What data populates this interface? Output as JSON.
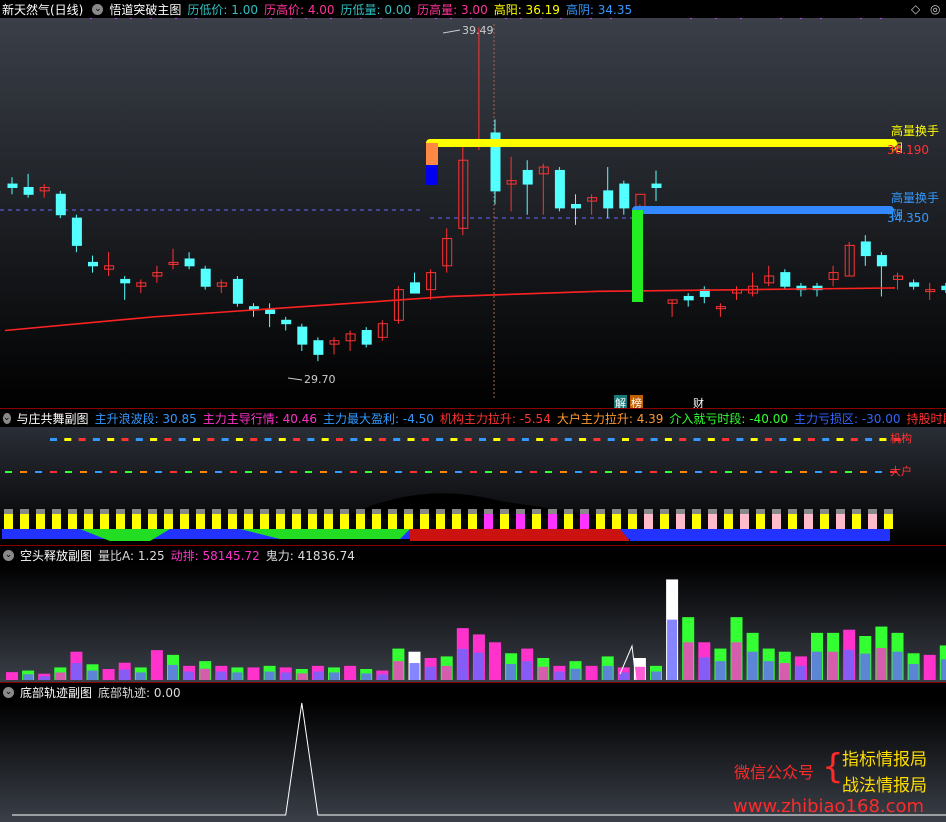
{
  "main": {
    "stock_name": "新天然气(日线)",
    "indicator_name": "悟道突破主图",
    "params": [
      {
        "label": "历低价:",
        "value": "1.00",
        "color": "#30c0c0"
      },
      {
        "label": "历高价:",
        "value": "4.00",
        "color": "#ff3399"
      },
      {
        "label": "历低量:",
        "value": "0.00",
        "color": "#30c0c0"
      },
      {
        "label": "历高量:",
        "value": "3.00",
        "color": "#ff3399"
      },
      {
        "label": "高阳:",
        "value": "36.19",
        "color": "#ffff00"
      },
      {
        "label": "高阴:",
        "value": "34.35",
        "color": "#3399ff"
      }
    ],
    "high_label": "39.49",
    "low_label": "29.70",
    "hline1": {
      "text": "高量换手阳",
      "value": "36.190"
    },
    "hline2": {
      "text": "高量换手阴",
      "value": "34.350"
    },
    "event_tags": [
      "解",
      "榜",
      "财"
    ]
  },
  "sub1": {
    "name": "与庄共舞副图",
    "params": [
      {
        "label": "主升浪波段:",
        "value": "30.85",
        "color": "#3399ff"
      },
      {
        "label": "主力主导行情:",
        "value": "40.46",
        "color": "#ff33cc"
      },
      {
        "label": "主力最大盈利:",
        "value": "-4.50",
        "color": "#3399ff"
      },
      {
        "label": "机构主力拉升:",
        "value": "-5.54",
        "color": "#ff3333"
      },
      {
        "label": "大户主力拉升:",
        "value": "4.39",
        "color": "#ff9933"
      },
      {
        "label": "介入就亏时段:",
        "value": "-40.00",
        "color": "#33ff33"
      },
      {
        "label": "主力亏损区:",
        "value": "-30.00",
        "color": "#3366ff"
      },
      {
        "label": "持股时段:",
        "value": "0.00",
        "color": "#ff3333"
      }
    ],
    "label_jigou": "机构",
    "label_dahu": "大户"
  },
  "sub2": {
    "name": "空头释放副图",
    "params": [
      {
        "label": "量比A:",
        "value": "1.25",
        "color": "#dddddd"
      },
      {
        "label": "动排:",
        "value": "58145.72",
        "color": "#ff33cc"
      },
      {
        "label": "鬼力:",
        "value": "41836.74",
        "color": "#dddddd"
      }
    ]
  },
  "sub3": {
    "name": "底部轨迹副图",
    "params": [
      {
        "label": "底部轨迹:",
        "value": "0.00",
        "color": "#dddddd"
      }
    ]
  },
  "watermark": {
    "line1": "微信公众号",
    "brand1": "指标情报局",
    "brand2": "战法情报局",
    "url": "www.zhibiao168.com"
  },
  "chart_data": {
    "type": "candlestick",
    "ylim": [
      29.0,
      39.6
    ],
    "candles": [
      {
        "o": 34.9,
        "h": 35.1,
        "l": 34.6,
        "c": 34.8
      },
      {
        "o": 34.8,
        "h": 35.2,
        "l": 34.5,
        "c": 34.6
      },
      {
        "o": 34.7,
        "h": 34.9,
        "l": 34.5,
        "c": 34.8
      },
      {
        "o": 34.6,
        "h": 34.7,
        "l": 33.9,
        "c": 34.0
      },
      {
        "o": 33.9,
        "h": 34.0,
        "l": 32.9,
        "c": 33.1
      },
      {
        "o": 32.6,
        "h": 32.8,
        "l": 32.3,
        "c": 32.5
      },
      {
        "o": 32.4,
        "h": 32.9,
        "l": 32.2,
        "c": 32.5
      },
      {
        "o": 32.1,
        "h": 32.2,
        "l": 31.5,
        "c": 32.0
      },
      {
        "o": 31.9,
        "h": 32.1,
        "l": 31.7,
        "c": 32.0
      },
      {
        "o": 32.2,
        "h": 32.5,
        "l": 32.0,
        "c": 32.3
      },
      {
        "o": 32.6,
        "h": 33.0,
        "l": 32.4,
        "c": 32.6
      },
      {
        "o": 32.7,
        "h": 32.9,
        "l": 32.4,
        "c": 32.5
      },
      {
        "o": 32.4,
        "h": 32.5,
        "l": 31.8,
        "c": 31.9
      },
      {
        "o": 31.9,
        "h": 32.1,
        "l": 31.7,
        "c": 32.0
      },
      {
        "o": 32.1,
        "h": 32.2,
        "l": 31.3,
        "c": 31.4
      },
      {
        "o": 31.3,
        "h": 31.4,
        "l": 31.0,
        "c": 31.2
      },
      {
        "o": 31.2,
        "h": 31.4,
        "l": 30.7,
        "c": 31.1
      },
      {
        "o": 30.9,
        "h": 31.0,
        "l": 30.6,
        "c": 30.8
      },
      {
        "o": 30.7,
        "h": 30.8,
        "l": 30.0,
        "c": 30.2
      },
      {
        "o": 30.3,
        "h": 30.4,
        "l": 29.7,
        "c": 29.9
      },
      {
        "o": 30.2,
        "h": 30.4,
        "l": 29.9,
        "c": 30.3
      },
      {
        "o": 30.3,
        "h": 30.6,
        "l": 30.0,
        "c": 30.5
      },
      {
        "o": 30.6,
        "h": 30.7,
        "l": 30.1,
        "c": 30.2
      },
      {
        "o": 30.4,
        "h": 30.9,
        "l": 30.3,
        "c": 30.8
      },
      {
        "o": 30.9,
        "h": 31.9,
        "l": 30.8,
        "c": 31.8
      },
      {
        "o": 32.0,
        "h": 32.3,
        "l": 31.7,
        "c": 31.7
      },
      {
        "o": 31.8,
        "h": 32.4,
        "l": 31.5,
        "c": 32.3
      },
      {
        "o": 32.5,
        "h": 33.6,
        "l": 32.3,
        "c": 33.3
      },
      {
        "o": 33.6,
        "h": 36.0,
        "l": 33.4,
        "c": 35.6
      },
      {
        "o": 36.2,
        "h": 39.5,
        "l": 35.9,
        "c": 36.2
      },
      {
        "o": 36.4,
        "h": 36.8,
        "l": 34.3,
        "c": 34.7
      },
      {
        "o": 34.9,
        "h": 35.7,
        "l": 34.1,
        "c": 35.0
      },
      {
        "o": 35.3,
        "h": 35.6,
        "l": 34.0,
        "c": 34.9
      },
      {
        "o": 35.2,
        "h": 35.5,
        "l": 34.0,
        "c": 35.4
      },
      {
        "o": 35.3,
        "h": 35.4,
        "l": 34.1,
        "c": 34.2
      },
      {
        "o": 34.3,
        "h": 34.6,
        "l": 33.7,
        "c": 34.2
      },
      {
        "o": 34.4,
        "h": 34.6,
        "l": 34.0,
        "c": 34.5
      },
      {
        "o": 34.7,
        "h": 35.4,
        "l": 33.9,
        "c": 34.2
      },
      {
        "o": 34.9,
        "h": 35.0,
        "l": 34.0,
        "c": 34.2
      },
      {
        "o": 34.1,
        "h": 34.3,
        "l": 33.8,
        "c": 34.6
      },
      {
        "o": 34.9,
        "h": 35.3,
        "l": 34.4,
        "c": 34.8
      },
      {
        "o": 31.4,
        "h": 31.5,
        "l": 31.0,
        "c": 31.5
      },
      {
        "o": 31.6,
        "h": 31.7,
        "l": 31.3,
        "c": 31.5
      },
      {
        "o": 31.8,
        "h": 31.9,
        "l": 31.4,
        "c": 31.6
      },
      {
        "o": 31.3,
        "h": 31.4,
        "l": 31.0,
        "c": 31.3
      },
      {
        "o": 31.7,
        "h": 31.9,
        "l": 31.5,
        "c": 31.8
      },
      {
        "o": 31.7,
        "h": 32.3,
        "l": 31.6,
        "c": 31.9
      },
      {
        "o": 32.0,
        "h": 32.5,
        "l": 31.9,
        "c": 32.2
      },
      {
        "o": 32.3,
        "h": 32.4,
        "l": 31.8,
        "c": 31.9
      },
      {
        "o": 31.9,
        "h": 32.0,
        "l": 31.6,
        "c": 31.8
      },
      {
        "o": 31.9,
        "h": 32.0,
        "l": 31.6,
        "c": 31.8
      },
      {
        "o": 32.1,
        "h": 32.5,
        "l": 31.9,
        "c": 32.3
      },
      {
        "o": 32.2,
        "h": 33.2,
        "l": 32.2,
        "c": 33.1
      },
      {
        "o": 33.2,
        "h": 33.4,
        "l": 32.5,
        "c": 32.8
      },
      {
        "o": 32.8,
        "h": 32.9,
        "l": 31.6,
        "c": 32.5
      },
      {
        "o": 32.1,
        "h": 32.3,
        "l": 31.8,
        "c": 32.2
      },
      {
        "o": 32.0,
        "h": 32.1,
        "l": 31.8,
        "c": 31.9
      },
      {
        "o": 31.8,
        "h": 32.0,
        "l": 31.5,
        "c": 31.8
      },
      {
        "o": 31.9,
        "h": 32.0,
        "l": 31.7,
        "c": 31.8
      },
      {
        "o": 31.8,
        "h": 32.9,
        "l": 31.7,
        "c": 32.3
      }
    ],
    "ma": [
      30.6,
      31.0,
      31.3,
      31.6,
      31.75,
      31.8,
      31.85
    ],
    "volume": [
      {
        "v": 5,
        "c": "#ff33cc"
      },
      {
        "v": 6,
        "c": "#33ff33"
      },
      {
        "v": 4,
        "c": "#ff33cc"
      },
      {
        "v": 8,
        "c": "#33ff33"
      },
      {
        "v": 18,
        "c": "#ff33cc"
      },
      {
        "v": 10,
        "c": "#33ff33"
      },
      {
        "v": 7,
        "c": "#ff33cc"
      },
      {
        "v": 11,
        "c": "#ff33cc"
      },
      {
        "v": 8,
        "c": "#33ff33"
      },
      {
        "v": 19,
        "c": "#ff33cc"
      },
      {
        "v": 16,
        "c": "#33ff33"
      },
      {
        "v": 9,
        "c": "#ff33cc"
      },
      {
        "v": 12,
        "c": "#33ff33"
      },
      {
        "v": 9,
        "c": "#ff33cc"
      },
      {
        "v": 8,
        "c": "#33ff33"
      },
      {
        "v": 8,
        "c": "#ff33cc"
      },
      {
        "v": 9,
        "c": "#33ff33"
      },
      {
        "v": 8,
        "c": "#ff33cc"
      },
      {
        "v": 7,
        "c": "#33ff33"
      },
      {
        "v": 9,
        "c": "#ff33cc"
      },
      {
        "v": 8,
        "c": "#33ff33"
      },
      {
        "v": 9,
        "c": "#ff33cc"
      },
      {
        "v": 7,
        "c": "#33ff33"
      },
      {
        "v": 6,
        "c": "#ff33cc"
      },
      {
        "v": 20,
        "c": "#33ff33"
      },
      {
        "v": 18,
        "c": "#ffffff"
      },
      {
        "v": 14,
        "c": "#ff33cc"
      },
      {
        "v": 15,
        "c": "#33ff33"
      },
      {
        "v": 33,
        "c": "#ff33cc"
      },
      {
        "v": 29,
        "c": "#ff33cc"
      },
      {
        "v": 24,
        "c": "#ff33cc"
      },
      {
        "v": 17,
        "c": "#33ff33"
      },
      {
        "v": 20,
        "c": "#ff33cc"
      },
      {
        "v": 14,
        "c": "#33ff33"
      },
      {
        "v": 9,
        "c": "#ff33cc"
      },
      {
        "v": 12,
        "c": "#33ff33"
      },
      {
        "v": 9,
        "c": "#ff33cc"
      },
      {
        "v": 15,
        "c": "#33ff33"
      },
      {
        "v": 8,
        "c": "#ff33cc"
      },
      {
        "v": 14,
        "c": "#ffffff"
      },
      {
        "v": 9,
        "c": "#33ff33"
      },
      {
        "v": 64,
        "c": "#ffffff"
      },
      {
        "v": 40,
        "c": "#33ff33"
      },
      {
        "v": 24,
        "c": "#ff33cc"
      },
      {
        "v": 20,
        "c": "#33ff33"
      },
      {
        "v": 40,
        "c": "#33ff33"
      },
      {
        "v": 30,
        "c": "#33ff33"
      },
      {
        "v": 20,
        "c": "#33ff33"
      },
      {
        "v": 18,
        "c": "#33ff33"
      },
      {
        "v": 15,
        "c": "#ff33cc"
      },
      {
        "v": 30,
        "c": "#33ff33"
      },
      {
        "v": 30,
        "c": "#33ff33"
      },
      {
        "v": 32,
        "c": "#ff33cc"
      },
      {
        "v": 28,
        "c": "#33ff33"
      },
      {
        "v": 34,
        "c": "#33ff33"
      },
      {
        "v": 30,
        "c": "#33ff33"
      },
      {
        "v": 17,
        "c": "#33ff33"
      },
      {
        "v": 16,
        "c": "#ff33cc"
      },
      {
        "v": 22,
        "c": "#33ff33"
      },
      {
        "v": 30,
        "c": "#33ff33"
      }
    ],
    "bottom_track": [
      0,
      0,
      0,
      0,
      0,
      0,
      0,
      0,
      0,
      0,
      0,
      0,
      0,
      0,
      0,
      0,
      0,
      0,
      1,
      0,
      0,
      0,
      0,
      0,
      0,
      0,
      0,
      0,
      0,
      0,
      0,
      0,
      0,
      0,
      0,
      0,
      0,
      0,
      0,
      0,
      0,
      0,
      0,
      0,
      0,
      0,
      0,
      0,
      0,
      0,
      0,
      0,
      0,
      0,
      0,
      0,
      0,
      0,
      0,
      0
    ]
  }
}
